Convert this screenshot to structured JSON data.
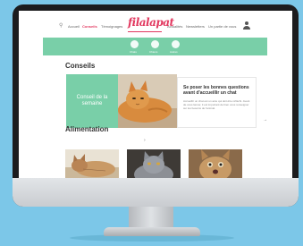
{
  "nav": {
    "items": [
      {
        "label": "Accueil",
        "active": false
      },
      {
        "label": "Conseils",
        "active": true
      },
      {
        "label": "Témoignages",
        "active": false
      },
      {
        "label": "Actualités",
        "active": false
      },
      {
        "label": "Newsletters",
        "active": false
      },
      {
        "label": "Un partie de vous",
        "active": false
      }
    ],
    "logo": "filalapat",
    "icons": [
      "search-icon",
      "user-icon"
    ]
  },
  "band": {
    "items": [
      "Chats",
      "Chiens",
      "Autres"
    ]
  },
  "sections": {
    "conseils": "Conseils",
    "alimentation": "Alimentation"
  },
  "featured": {
    "badge": "Conseil de la semaine",
    "title": "Se poser les bonnes questions avant d'accueillir un chat",
    "excerpt": "Accueillir un chat est un acte qui doit être réfléchi. Avant de vous lancer, il est important de bien vous renseigner sur les besoins de l'animal."
  },
  "colors": {
    "accent": "#e2385f",
    "green": "#79cfa8",
    "background": "#7cc7e8"
  }
}
